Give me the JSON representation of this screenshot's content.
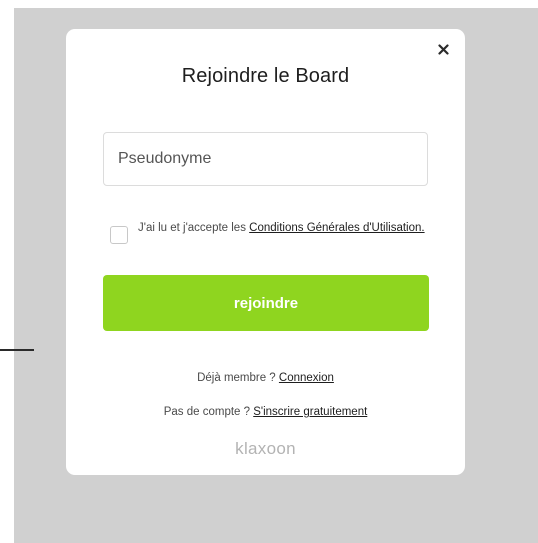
{
  "modal": {
    "title": "Rejoindre le Board",
    "close_icon": "close-icon",
    "pseudo_placeholder": "Pseudonyme",
    "pseudo_value": "",
    "terms": {
      "checked": false,
      "text": "J'ai lu et j'accepte les ",
      "link": "Conditions Générales d'Utilisation."
    },
    "join_button": "rejoindre",
    "login": {
      "text": "Déjà membre ?",
      "link": "Connexion"
    },
    "signup": {
      "text": "Pas de compte ?",
      "link": "S'inscrire gratuitement"
    },
    "logo": "klaxoon"
  },
  "colors": {
    "accent": "#8fd51f",
    "overlay": "#d0d0d0"
  }
}
